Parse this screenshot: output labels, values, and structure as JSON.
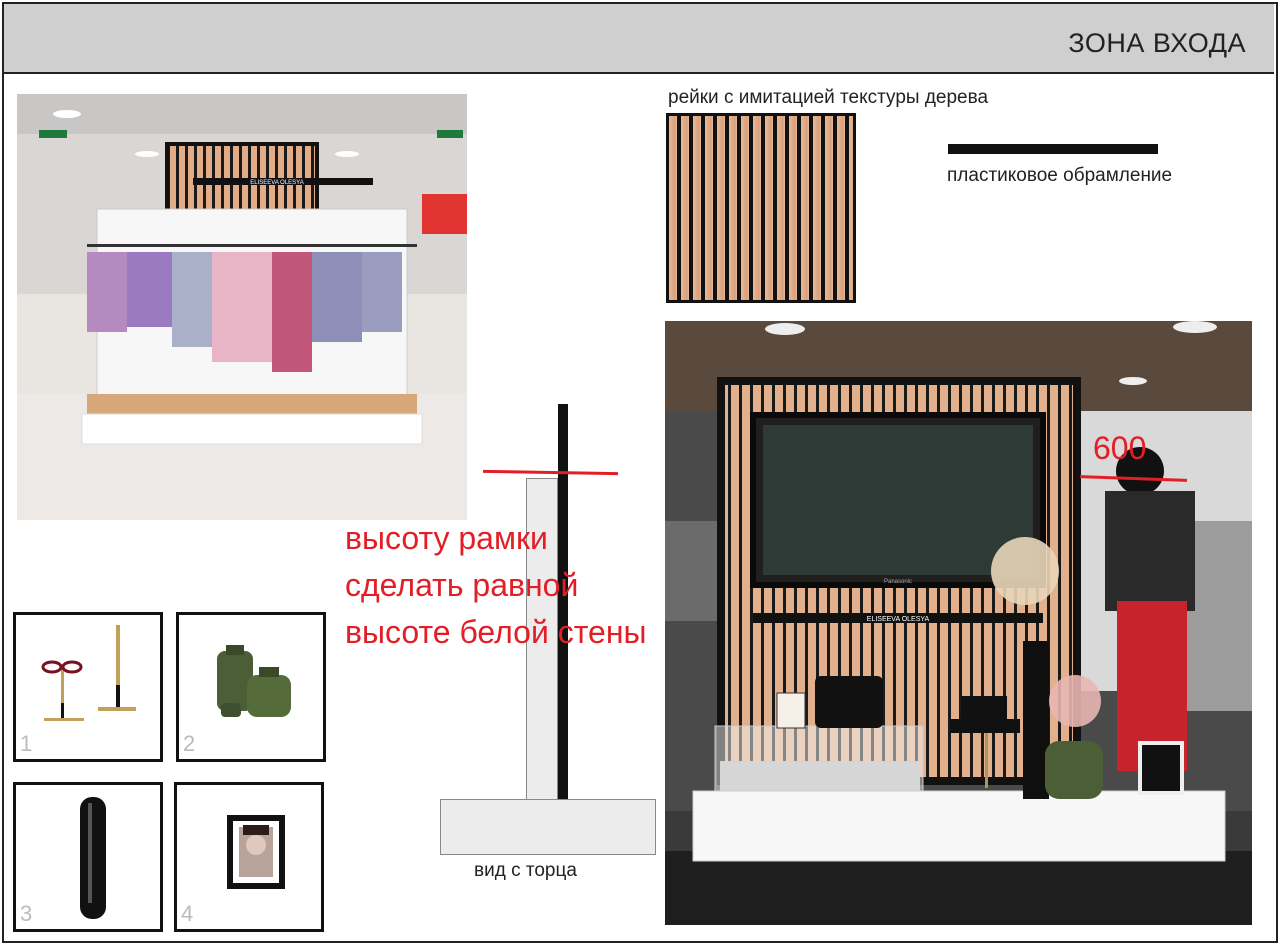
{
  "header": {
    "title": "ЗОНА ВХОДА"
  },
  "photo1": {
    "brand_sign": "ELISEEVA OLESYA"
  },
  "materials": {
    "slats_label": "рейки с имитацией текстуры дерева",
    "frame_label": "пластиковое обрамление"
  },
  "section": {
    "caption": "вид с торца"
  },
  "note": {
    "line1": "высоту рамки",
    "line2": "сделать равной",
    "line3": "высоте белой стены"
  },
  "thumbnails": [
    {
      "number": "1",
      "icon": "glasses-stand-icon"
    },
    {
      "number": "2",
      "icon": "green-vases-icon"
    },
    {
      "number": "3",
      "icon": "black-cylinder-vase-icon"
    },
    {
      "number": "4",
      "icon": "photo-frame-icon"
    }
  ],
  "photo2": {
    "brand_sign": "ELISEEVA OLESYA",
    "tv_brand": "Panasonic",
    "dimension": "600"
  },
  "colors": {
    "accent_red": "#e21f26",
    "header_bg": "#cfcfcf",
    "wood": "#e3b08e"
  }
}
